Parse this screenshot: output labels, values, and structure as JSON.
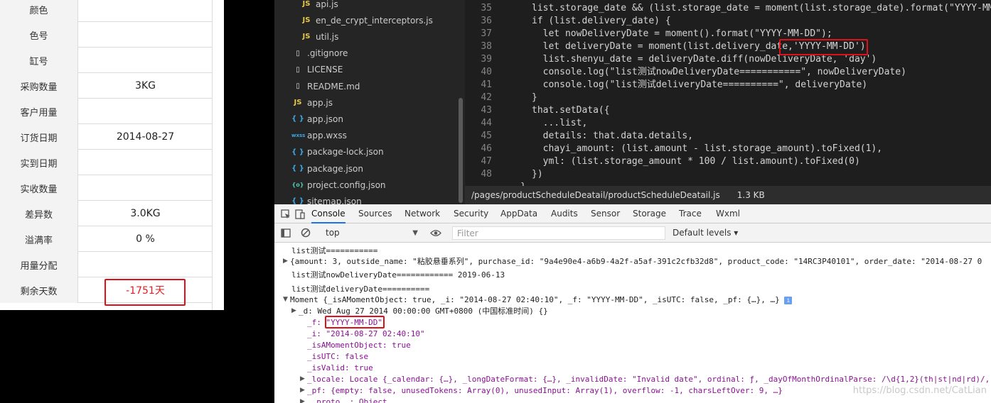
{
  "form": {
    "rows": [
      {
        "label": "颜色",
        "value": ""
      },
      {
        "label": "色号",
        "value": ""
      },
      {
        "label": "缸号",
        "value": ""
      },
      {
        "label": "采购数量",
        "value": "3KG"
      },
      {
        "label": "客户用量",
        "value": ""
      },
      {
        "label": "订货日期",
        "value": "2014-08-27"
      },
      {
        "label": "实到日期",
        "value": ""
      },
      {
        "label": "实收数量",
        "value": ""
      },
      {
        "label": "差异数",
        "value": "3.0KG"
      },
      {
        "label": "溢满率",
        "value": "0 %"
      },
      {
        "label": "用量分配",
        "value": ""
      },
      {
        "label": "剩余天数",
        "value": "-1751天"
      }
    ],
    "negative_color": "#e02020"
  },
  "file_tree": {
    "items": [
      {
        "name": "api.js",
        "icon": "js-file-icon",
        "glyph": "JS"
      },
      {
        "name": "en_de_crypt_interceptors.js",
        "icon": "js-file-icon",
        "glyph": "JS"
      },
      {
        "name": "util.js",
        "icon": "js-file-icon",
        "glyph": "JS"
      },
      {
        "name": ".gitignore",
        "icon": "file-icon",
        "glyph": "▯"
      },
      {
        "name": "LICENSE",
        "icon": "file-icon",
        "glyph": "▯"
      },
      {
        "name": "README.md",
        "icon": "file-icon",
        "glyph": "▯"
      },
      {
        "name": "app.js",
        "icon": "js-file-icon",
        "glyph": "JS"
      },
      {
        "name": "app.json",
        "icon": "json-file-icon",
        "glyph": "{ }"
      },
      {
        "name": "app.wxss",
        "icon": "wxss-file-icon",
        "glyph": "wxss"
      },
      {
        "name": "package-lock.json",
        "icon": "json-file-icon",
        "glyph": "{ }"
      },
      {
        "name": "package.json",
        "icon": "json-file-icon",
        "glyph": "{ }"
      },
      {
        "name": "project.config.json",
        "icon": "config-file-icon",
        "glyph": "{o}"
      },
      {
        "name": "sitemap.json",
        "icon": "json-file-icon",
        "glyph": "{ }"
      }
    ]
  },
  "editor": {
    "line_numbers": [
      "35",
      "36",
      "37",
      "38",
      "39",
      "40",
      "41",
      "42",
      "43",
      "44",
      "45",
      "46",
      "47",
      "48"
    ],
    "lines": [
      "list.storage_date && (list.storage_date = moment(list.storage_date).format(\"YYYY-MM-",
      "if (list.delivery_date) {",
      "  let nowDeliveryDate = moment().format(\"YYYY-MM-DD\");",
      "  let deliveryDate = moment(list.delivery_date,'YYYY-MM-DD')",
      "  list.shenyu_date = deliveryDate.diff(nowDeliveryDate, 'day')",
      "  console.log(\"list测试nowDeliveryDate===========\", nowDeliveryDate)",
      "  console.log(\"list测试deliveryDate==========\", deliveryDate)",
      "}",
      "that.setData({",
      "  ...list,",
      "  details: that.data.details,",
      "  chayi_amount: (list.amount - list.storage_amount).toFixed(1),",
      "  yml: (list.storage_amount * 100 / list.amount).toFixed(0)",
      "})"
    ],
    "partial_line": "}"
  },
  "status_bar": {
    "path": "/pages/productScheduleDeatail/productScheduleDeatail.js",
    "size": "1.3 KB"
  },
  "devtools": {
    "tabs": [
      "Console",
      "Sources",
      "Network",
      "Security",
      "AppData",
      "Audits",
      "Sensor",
      "Storage",
      "Trace",
      "Wxml"
    ],
    "active_tab": "Console",
    "context": "top",
    "filter_placeholder": "Filter",
    "levels": "Default levels ▾",
    "console": {
      "l1": "list测试===========",
      "l2": "{amount: 3, outside_name: \"粘胶悬垂系列\", purchase_id: \"9a4e90e4-a6b9-4a2f-a5af-391c2cfb32d8\", product_code: \"14RC3P40101\", order_date: \"2014-08-27 0",
      "l3": "list测试nowDeliveryDate============ 2019-06-13",
      "l4": "list测试deliveryDate==========",
      "l5": "Moment {_isAMomentObject: true, _i: \"2014-08-27 02:40:10\", _f: \"YYYY-MM-DD\", _isUTC: false, _pf: {…}, …}",
      "l5_badge": "i",
      "l6": "_d: Wed Aug 27 2014 00:00:00 GMT+0800 (中国标准时间) {}",
      "l7": "_f: \"YYYY-MM-DD\"",
      "l8": "_i: \"2014-08-27 02:40:10\"",
      "l9": "_isAMomentObject: true",
      "l10": "_isUTC: false",
      "l11": "_isValid: true",
      "l12": "_locale: Locale {_calendar: {…}, _longDateFormat: {…}, _invalidDate: \"Invalid date\", ordinal: ƒ, _dayOfMonthOrdinalParse: /\\d{1,2}(th|st|nd|rd)/,",
      "l13": "_pf: {empty: false, unusedTokens: Array(0), unusedInput: Array(1), overflow: -1, charsLeftOver: 9, …}",
      "l14": "__proto__: Object"
    }
  },
  "watermark": "https://blog.csdn.net/CatLian",
  "highlight_color": "#e0101b"
}
